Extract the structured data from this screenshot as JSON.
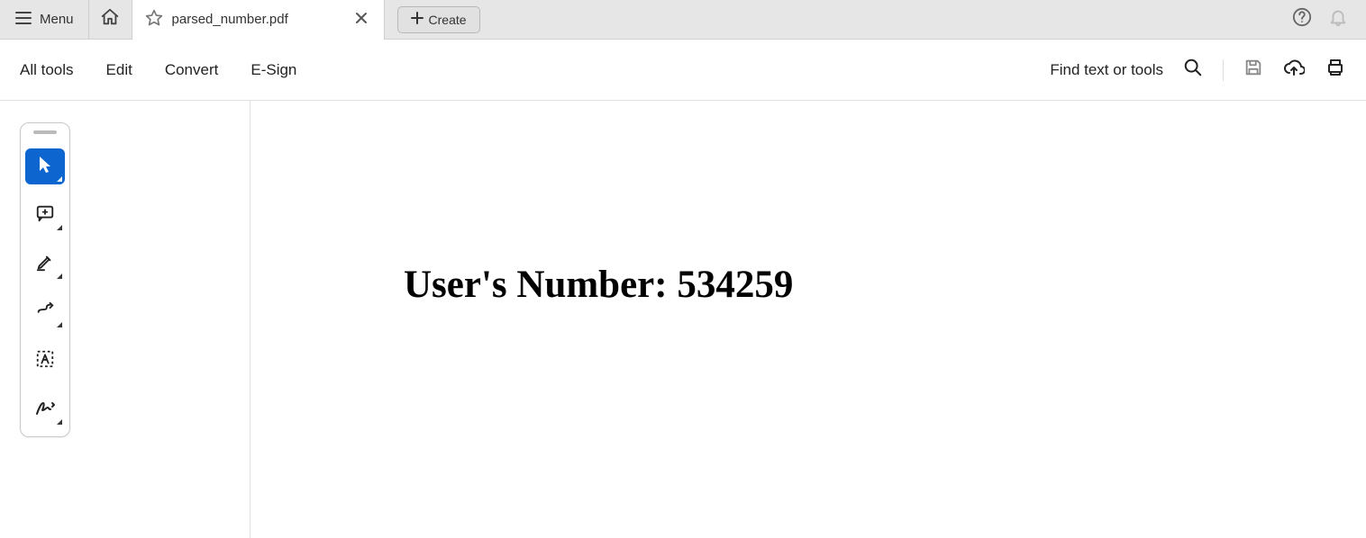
{
  "tabbar": {
    "menu_label": "Menu",
    "tab_title": "parsed_number.pdf",
    "create_label": "Create"
  },
  "toolbar": {
    "all_tools": "All tools",
    "edit": "Edit",
    "convert": "Convert",
    "esign": "E-Sign",
    "find_label": "Find text or tools"
  },
  "document": {
    "heading": "User's Number: 534259"
  }
}
